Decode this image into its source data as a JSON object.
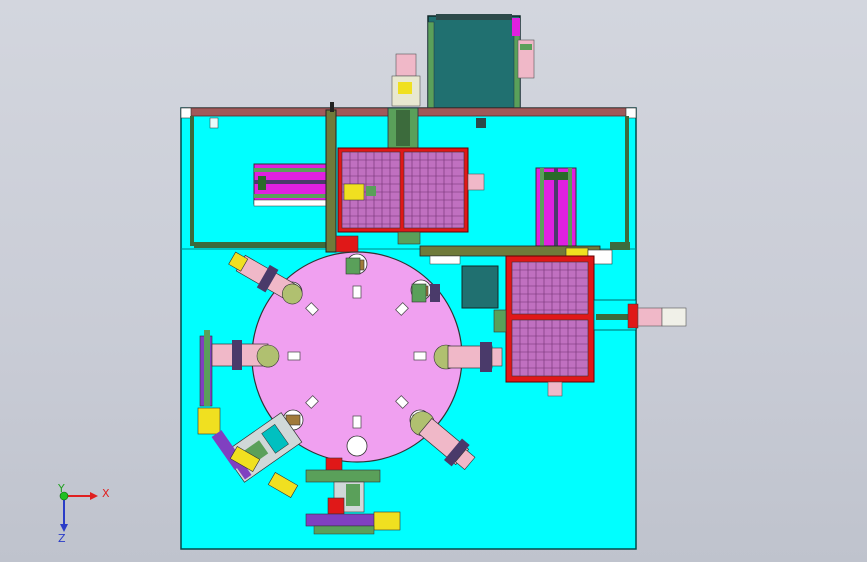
{
  "view": {
    "background_top": "#d3d6de",
    "background_bottom": "#bfc3cd"
  },
  "colors": {
    "base_plate": "#00ffff",
    "rotary_table": "#f0a0f0",
    "tray_frame": "#e01818",
    "tray_fill": "#c070c0",
    "feeder_magenta": "#e020e0",
    "rail_green": "#5aa05a",
    "rail_dark": "#3c6b3c",
    "beam_brown": "#a05a5a",
    "hopper_teal": "#207070",
    "motor_pink": "#f0b8c8",
    "cylinder_yellow": "#f0e020",
    "purple": "#8040c0",
    "axis_x": "#e02020",
    "axis_y": "#20c020",
    "axis_z": "#2a3cc8"
  },
  "triad": {
    "x_label": "X",
    "y_label": "Y",
    "z_label": "Z"
  }
}
